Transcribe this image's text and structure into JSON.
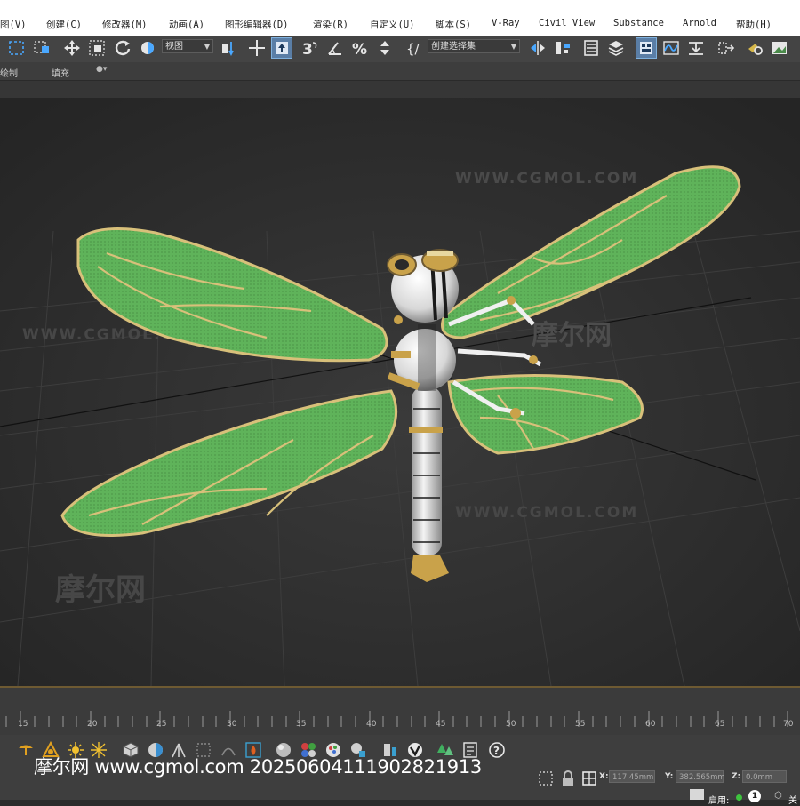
{
  "menu": {
    "items": [
      "图(V)",
      "创建(C)",
      "修改器(M)",
      "动画(A)",
      "图形编辑器(D)",
      "渲染(R)",
      "自定义(U)",
      "脚本(S)",
      "V-Ray",
      "Civil View",
      "Substance",
      "Arnold",
      "帮助(H)"
    ]
  },
  "toolbar": {
    "view_dropdown": "视图",
    "selection_set_dropdown": "创建选择集",
    "icons": [
      "select-region-icon",
      "window-crossing-icon",
      "move-icon",
      "scale-icon",
      "rotate-icon",
      "pivot-icon",
      "snap-icon",
      "angle-snap-icon",
      "percent-snap-icon",
      "spinner-snap-icon",
      "mirror-icon",
      "align-icon",
      "layer-icon",
      "scene-explorer-icon",
      "curve-editor-icon",
      "render-setup-icon",
      "render-frame-icon",
      "render-icon"
    ]
  },
  "ribbon": {
    "left_label": "绘制",
    "fill_label": "填充"
  },
  "viewport": {
    "watermark_url": "WWW.CGMOL.COM",
    "watermark_logo": "摩尔网",
    "subject": "dragonfly-model",
    "colors": {
      "wing_fill": "#5fb35a",
      "wing_vein": "#d8c07a",
      "body": "#e8e8e8",
      "gold": "#c9a24a",
      "background": "#2b2b2b",
      "grid": "#3a3a3a"
    }
  },
  "timeline": {
    "ticks": [
      "15",
      "20",
      "25",
      "30",
      "35",
      "40",
      "45",
      "50",
      "55",
      "60",
      "65",
      "70"
    ]
  },
  "status": {
    "x_label": "X:",
    "x_value": "117.45mm",
    "y_label": "Y:",
    "y_value": "382.565mm",
    "z_label": "Z:",
    "z_value": "0.0mm",
    "enable_label": "启用:",
    "frame_badge": "1",
    "extra": "关"
  },
  "overlay": {
    "watermark": "摩尔网 www.cgmol.com 20250604111902821913"
  }
}
